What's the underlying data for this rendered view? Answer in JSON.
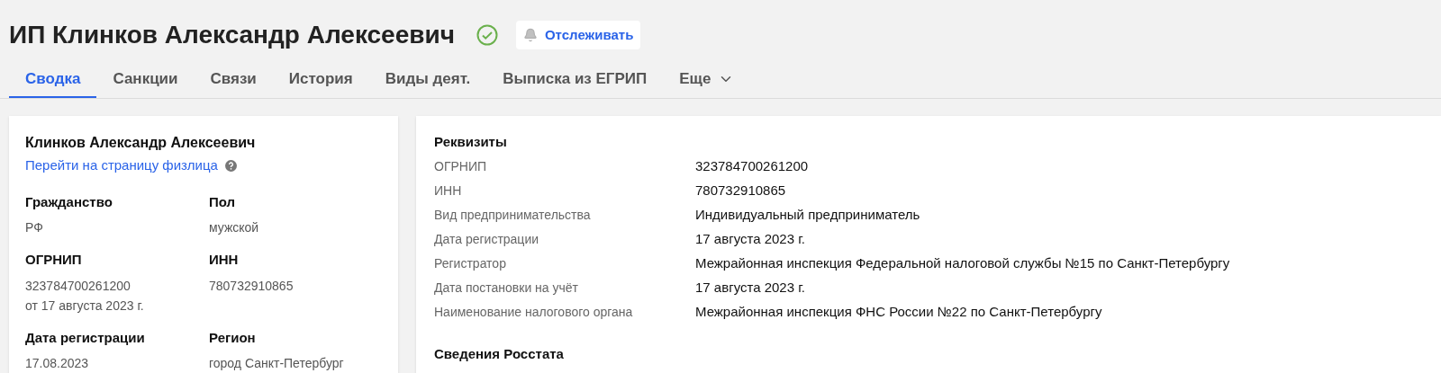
{
  "header": {
    "title": "ИП Клинков Александр Алексеевич",
    "verified": true,
    "follow_button": "Отслеживать"
  },
  "tabs": [
    {
      "label": "Сводка",
      "selected": true,
      "dropdown": false
    },
    {
      "label": "Санкции",
      "selected": false,
      "dropdown": false
    },
    {
      "label": "Связи",
      "selected": false,
      "dropdown": false
    },
    {
      "label": "История",
      "selected": false,
      "dropdown": false
    },
    {
      "label": "Виды деят.",
      "selected": false,
      "dropdown": false
    },
    {
      "label": "Выписка из ЕГРИП",
      "selected": false,
      "dropdown": false
    },
    {
      "label": "Еще",
      "selected": false,
      "dropdown": true
    }
  ],
  "person_card": {
    "name": "Клинков Александр Алексеевич",
    "link": "Перейти на страницу физлица",
    "fields": [
      {
        "label": "Гражданство",
        "values": [
          "РФ"
        ]
      },
      {
        "label": "Пол",
        "values": [
          "мужской"
        ]
      },
      {
        "label": "ОГРНИП",
        "values": [
          "323784700261200",
          "от 17 августа 2023 г."
        ]
      },
      {
        "label": "ИНН",
        "values": [
          "780732910865"
        ]
      },
      {
        "label": "Дата регистрации",
        "values": [
          "17.08.2023"
        ]
      },
      {
        "label": "Регион",
        "values": [
          "город Санкт-Петербург"
        ]
      }
    ]
  },
  "details_card": {
    "sections": [
      {
        "title": "Реквизиты",
        "rows": [
          {
            "label": "ОГРНИП",
            "value": "323784700261200"
          },
          {
            "label": "ИНН",
            "value": "780732910865"
          },
          {
            "label": "Вид предпринимательства",
            "value": "Индивидуальный предприниматель"
          },
          {
            "label": "Дата регистрации",
            "value": "17 августа 2023 г."
          },
          {
            "label": "Регистратор",
            "value": "Межрайонная инспекция Федеральной налоговой службы №15 по Санкт-Петербургу"
          },
          {
            "label": "Дата постановки на учёт",
            "value": "17 августа 2023 г."
          },
          {
            "label": "Наименование налогового органа",
            "value": "Межрайонная инспекция ФНС России №22 по Санкт-Петербургу"
          }
        ]
      },
      {
        "title": "Сведения Росстата"
      }
    ]
  }
}
